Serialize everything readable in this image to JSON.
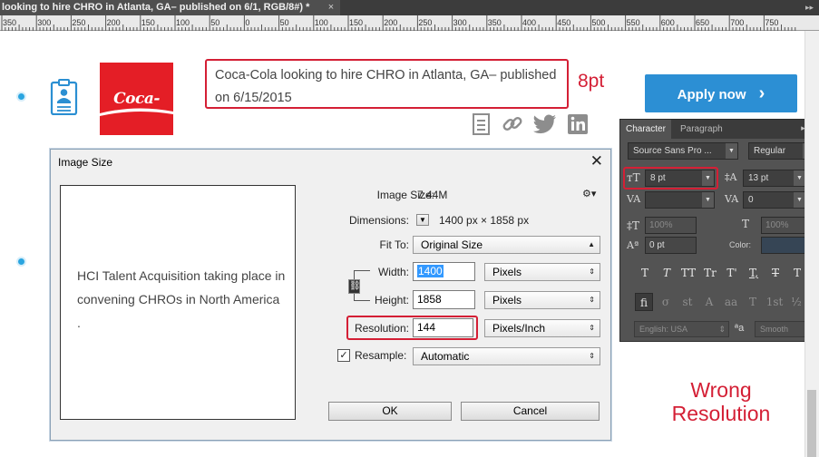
{
  "ps": {
    "document_tab": "looking  to hire CHRO in Atlanta, GA– published on 6/1, RGB/8#) *",
    "tab_close": "×",
    "panel_collapse": "▸▸"
  },
  "ruler": {
    "labels": [
      "350",
      "300",
      "250",
      "200",
      "150",
      "100",
      "50",
      "0",
      "50",
      "100",
      "150",
      "200",
      "250",
      "300",
      "350",
      "400",
      "450",
      "500",
      "550",
      "600",
      "650",
      "700",
      "750"
    ]
  },
  "webpage": {
    "job_title": "Coca-Cola looking to hire CHRO in Atlanta, GA– published on 6/15/2015",
    "logo_text": "Coca-Cola",
    "apply_button": "Apply now",
    "apply_chevron": "›",
    "annotation_8pt": "8pt",
    "annotation_wrong_resolution": "Wrong Resolution",
    "share_icons": [
      "document-icon",
      "link-icon",
      "twitter-icon",
      "linkedin-icon"
    ]
  },
  "character_panel": {
    "tab_character": "Character",
    "tab_paragraph": "Paragraph",
    "menu": "▸▸ ≡",
    "font_family": "Source Sans Pro ...",
    "font_style": "Regular",
    "font_size": "8 pt",
    "leading": "13 pt",
    "kerning": "",
    "tracking": "0",
    "vertical_scale": "100%",
    "horizontal_scale": "100%",
    "baseline_shift": "0 pt",
    "color_label": "Color:",
    "color_swatch": "#364555",
    "type_styles": [
      "T",
      "T",
      "TT",
      "Tr",
      "T'",
      "T,",
      "T",
      "T"
    ],
    "opentype": [
      "fi",
      "σ",
      "st",
      "A",
      "aa",
      "T",
      "1st",
      "½"
    ],
    "language": "English: USA",
    "aa_label": "ªa",
    "antialias": "Smooth"
  },
  "image_size_dialog": {
    "title": "Image Size",
    "close": "✕",
    "preview_text_lines": [
      "HCI Talent Acquisition taking place in",
      "convening CHROs in North America",
      "."
    ],
    "image_size_label": "Image Size:",
    "image_size_value": "7.44M",
    "gear": "⚙▾",
    "dimensions_label": "Dimensions:",
    "dimensions_value": "1400 px  ×  1858 px",
    "fit_to_label": "Fit To:",
    "fit_to_value": "Original Size",
    "width_label": "Width:",
    "width_value": "1400",
    "width_unit": "Pixels",
    "height_label": "Height:",
    "height_value": "1858",
    "height_unit": "Pixels",
    "resolution_label": "Resolution:",
    "resolution_value": "144",
    "resolution_unit": "Pixels/Inch",
    "resample_label": "Resample:",
    "resample_checked": "✓",
    "resample_value": "Automatic",
    "ok": "OK",
    "cancel": "Cancel"
  }
}
